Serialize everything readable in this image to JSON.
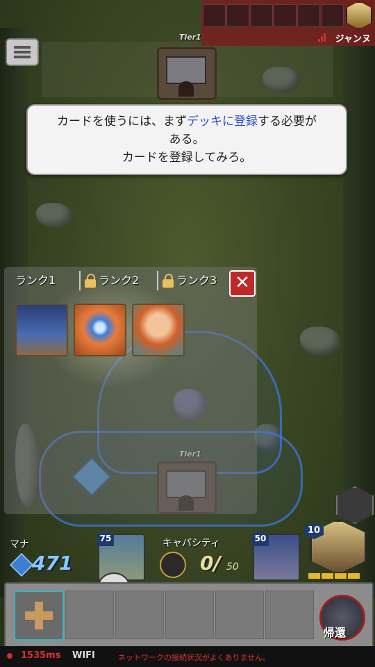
{
  "hud_top": {
    "player_name": "ジャンヌ",
    "enemy_tier_label": "Tier1"
  },
  "tooltip": {
    "line1_a": "カードを使うには、まず",
    "line1_highlight": "デッキに登録",
    "line1_b": "する必要が",
    "line2": "ある。",
    "line3": "カードを登録してみろ。"
  },
  "card_panel": {
    "tabs": [
      {
        "label": "ランク1",
        "locked": false
      },
      {
        "label": "ランク2",
        "locked": true
      },
      {
        "label": "ランク3",
        "locked": true
      }
    ],
    "close_glyph": "✕",
    "cards": [
      "tower-card",
      "mage-card",
      "warrior-card"
    ]
  },
  "ally_tier_label": "Tier1",
  "hud_bottom": {
    "mana_label": "マナ",
    "mana_value": "471",
    "unit_a_cost": "75",
    "capacity_label": "キャパシティ",
    "capacity_value": "0/",
    "capacity_max": "50",
    "unit_b_cost": "50",
    "hero_level": "10",
    "return_label": "帰還"
  },
  "status_bar": {
    "ping": "1535ms",
    "connection": "WIFI",
    "warning": "ネットワークの接続状況がよくありません。"
  },
  "colors": {
    "highlight": "#2a50d0",
    "accent_red": "#c0282a",
    "mana_blue": "#8cc8ff"
  }
}
